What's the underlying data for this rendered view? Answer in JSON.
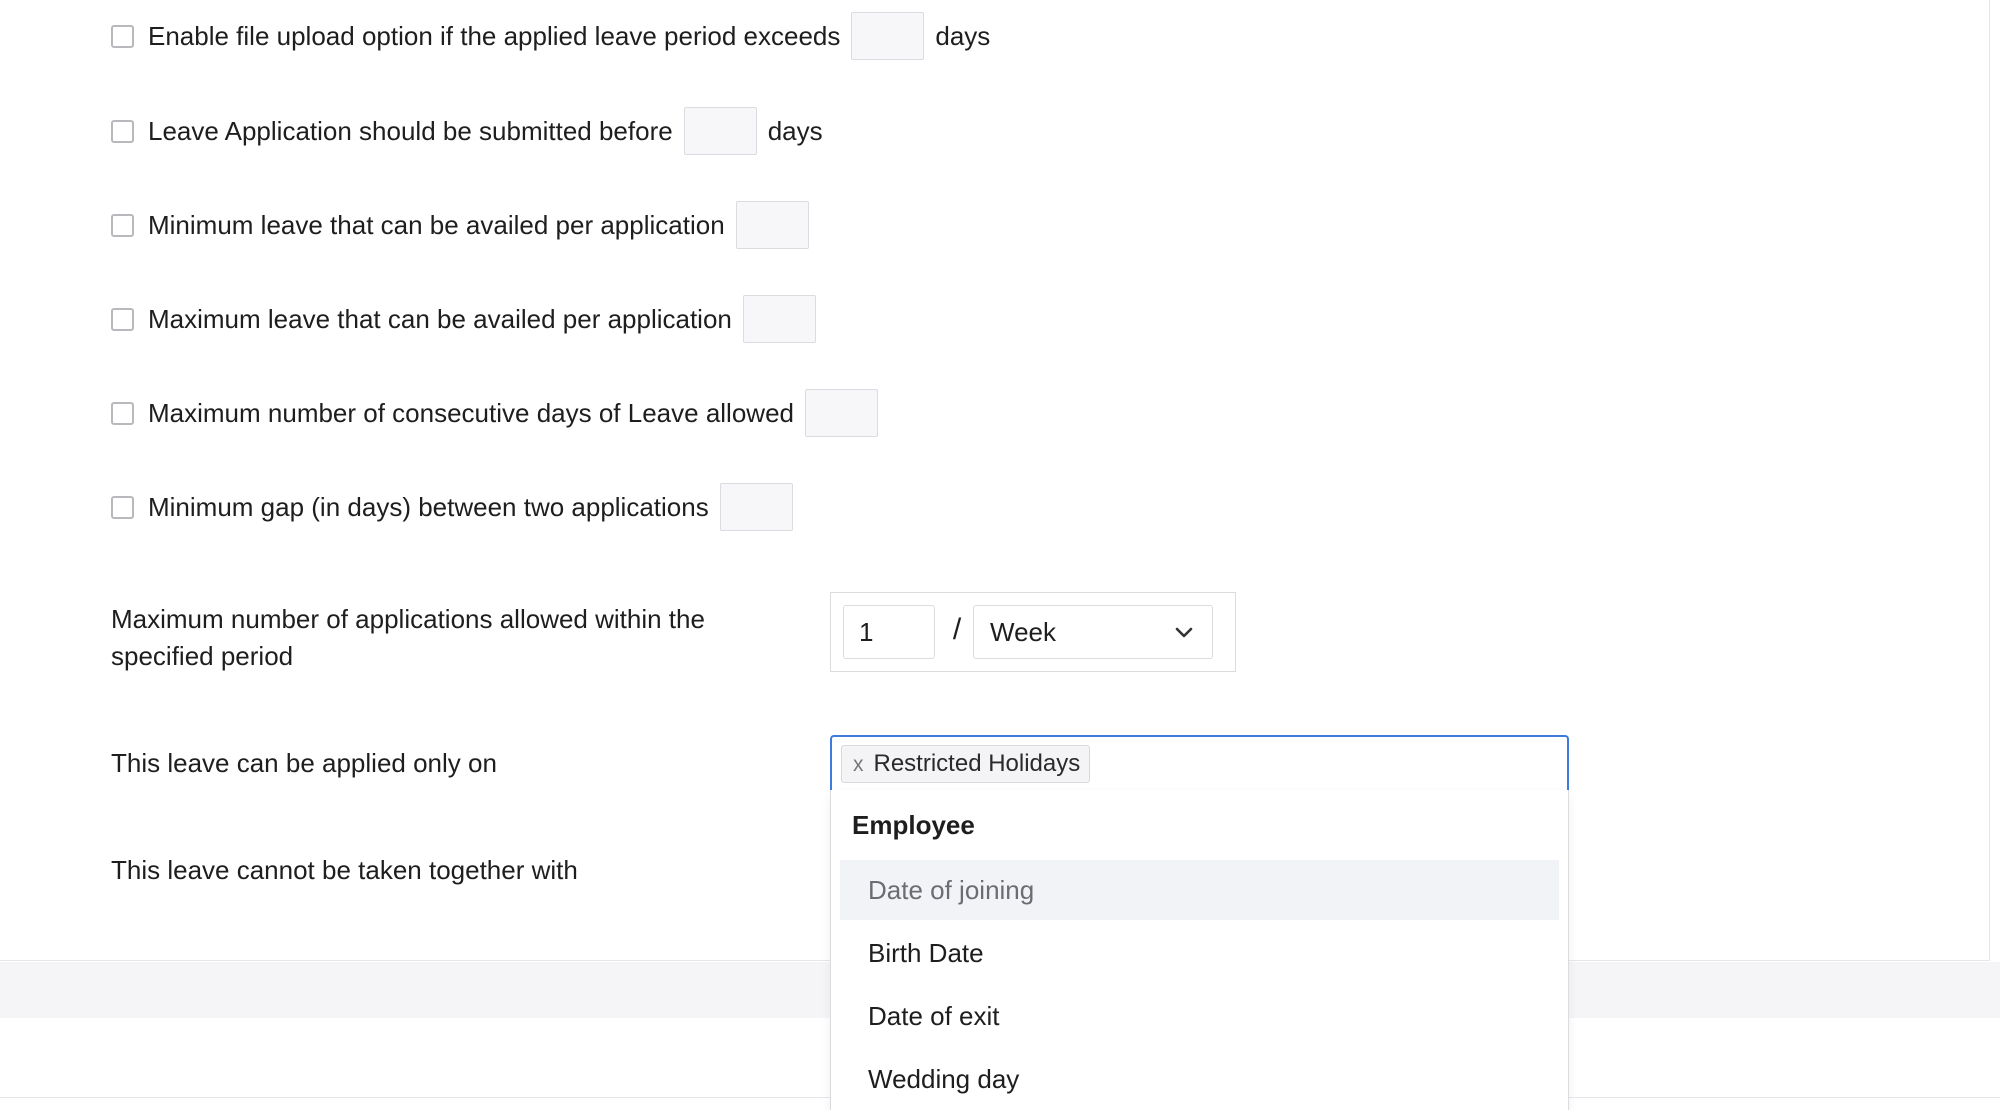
{
  "rules": [
    {
      "label": "Enable file upload option if the applied leave period exceeds",
      "value": "",
      "suffix": "days"
    },
    {
      "label": "Leave Application should be submitted before",
      "value": "",
      "suffix": "days"
    },
    {
      "label": "Minimum leave that can be availed per application",
      "value": "",
      "suffix": ""
    },
    {
      "label": "Maximum leave that can be availed per application",
      "value": "",
      "suffix": ""
    },
    {
      "label": "Maximum number of consecutive days of Leave allowed",
      "value": "",
      "suffix": ""
    },
    {
      "label": "Minimum gap (in days) between two applications",
      "value": "",
      "suffix": ""
    }
  ],
  "max_applications": {
    "label_line1": "Maximum number of applications allowed within the",
    "label_line2": "specified period",
    "count": "1",
    "separator": "/",
    "period": "Week"
  },
  "applied_only_on": {
    "label": "This leave can be applied only on",
    "tags": [
      "Restricted Holidays"
    ],
    "tag_remove_glyph": "x"
  },
  "cannot_combine": {
    "label": "This leave cannot be taken together with"
  },
  "dropdown": {
    "group": "Employee",
    "options": [
      "Date of joining",
      "Birth Date",
      "Date of exit",
      "Wedding day"
    ],
    "highlighted_index": 0
  },
  "colors": {
    "focus_border": "#3e7bdc",
    "highlight_bg": "#f2f3f7"
  }
}
